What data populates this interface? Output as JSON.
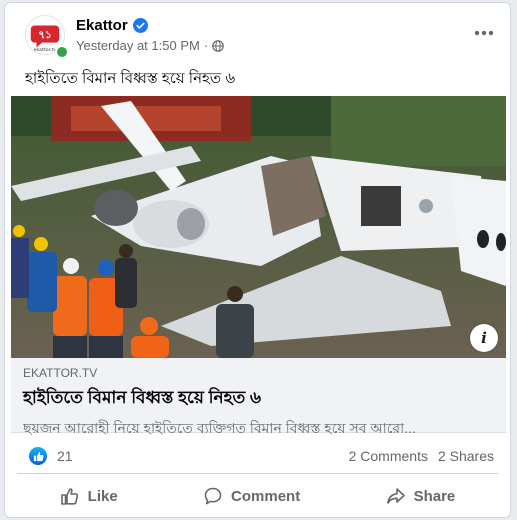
{
  "post": {
    "page_name": "Ekattor",
    "timestamp": "Yesterday at 1:50 PM",
    "separator": "·",
    "text": "হাইতিতে বিমান বিধ্বস্ত হয়ে নিহত ৬",
    "logo_text": "ekattor.tv"
  },
  "link": {
    "domain": "EKATTOR.TV",
    "title": "হাইতিতে বিমান বিধ্বস্ত হয়ে নিহত ৬",
    "description": "ছয়জন আরোহী নিয়ে হাইতিতে ব্যক্তিগত বিমান বিধ্বস্ত হয়ে সব আরো..."
  },
  "stats": {
    "reactions": "21",
    "comments": "2 Comments",
    "shares": "2 Shares"
  },
  "actions": {
    "like": "Like",
    "comment": "Comment",
    "share": "Share"
  },
  "icons": [
    "verified-icon",
    "globe-icon",
    "more-icon",
    "info-icon",
    "like-icon",
    "comment-icon",
    "share-icon"
  ],
  "colors": {
    "verified": "#1877f2",
    "online": "#31a24c",
    "link_bg": "#f0f2f5",
    "muted_text": "#65676b"
  }
}
